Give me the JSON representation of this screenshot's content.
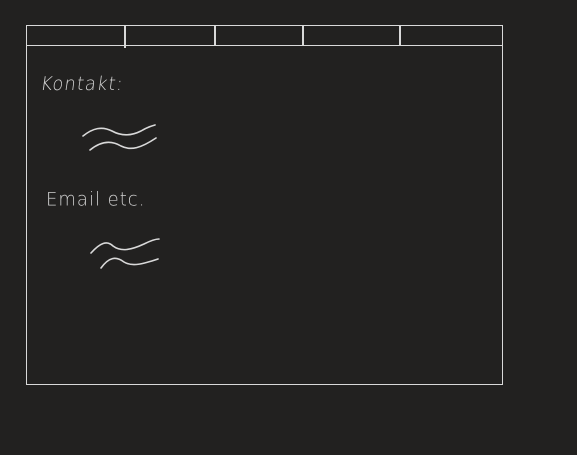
{
  "theme": {
    "background": "#222120",
    "stroke": "#d9d9d9"
  },
  "nav": {
    "tabs": [
      "",
      "",
      "",
      "",
      ""
    ]
  },
  "content": {
    "contact_label": "Kontakt:",
    "email_label": "Email etc."
  },
  "icons": {
    "placeholder": "squiggle-icon"
  }
}
